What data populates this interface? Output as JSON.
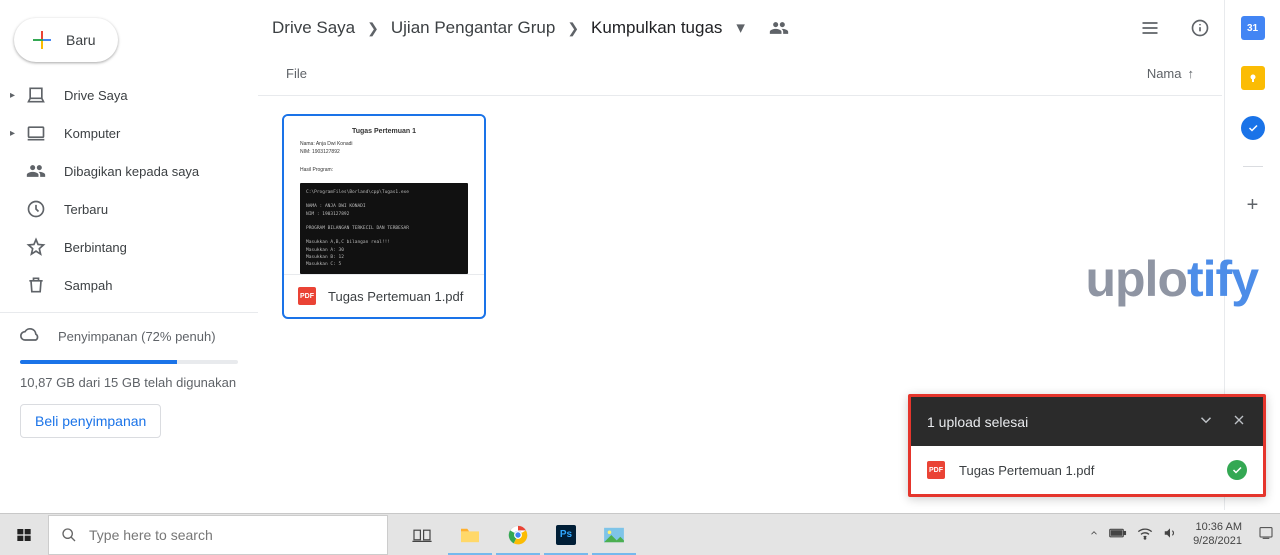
{
  "breadcrumb": {
    "root": "Drive Saya",
    "mid": "Ujian Pengantar Grup",
    "current": "Kumpulkan tugas"
  },
  "top_icons": {
    "people": "people-icon",
    "list_view": "list-view-icon",
    "info": "info-icon"
  },
  "sidebar": {
    "new_label": "Baru",
    "items": [
      {
        "icon": "my-drive-icon",
        "label": "Drive Saya",
        "expandable": true
      },
      {
        "icon": "computer-icon",
        "label": "Komputer",
        "expandable": true
      },
      {
        "icon": "shared-icon",
        "label": "Dibagikan kepada saya",
        "expandable": false
      },
      {
        "icon": "recent-icon",
        "label": "Terbaru",
        "expandable": false
      },
      {
        "icon": "star-icon",
        "label": "Berbintang",
        "expandable": false
      },
      {
        "icon": "trash-icon",
        "label": "Sampah",
        "expandable": false
      }
    ],
    "storage": {
      "label": "Penyimpanan (72% penuh)",
      "used_text": "10,87 GB dari 15 GB telah digunakan",
      "buy": "Beli penyimpanan",
      "percent": 72
    }
  },
  "columns": {
    "file": "File",
    "sort": "Nama"
  },
  "file": {
    "name": "Tugas Pertemuan 1.pdf",
    "badge": "PDF",
    "thumb_title": "Tugas Pertemuan 1",
    "thumb_line1": "Nama: Anja Dwi Konadi",
    "thumb_line2": "NIM: 1903127892",
    "thumb_line3": "Hasil Program:"
  },
  "toast": {
    "title": "1 upload selesai",
    "item": "Tugas Pertemuan 1.pdf"
  },
  "rail": {
    "cal_day": "31"
  },
  "taskbar": {
    "search_placeholder": "Type here to search",
    "time": "10:36 AM",
    "date": "9/28/2021"
  },
  "watermark": {
    "a": "uplo",
    "b": "tify"
  }
}
